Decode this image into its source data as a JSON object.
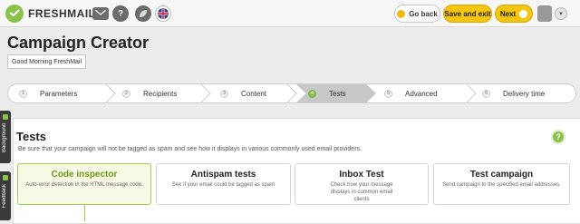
{
  "app": {
    "brand": "FRESHMAIL"
  },
  "toolbar": {
    "back_label": "Go back",
    "save_label": "Save and exit",
    "next_label": "Next",
    "help_glyph": "?",
    "caret_glyph": "▾"
  },
  "header": {
    "title": "Campaign Creator",
    "greeting": "Good Morning FreshMail"
  },
  "steps": [
    {
      "num": "1",
      "label": "Parameters"
    },
    {
      "num": "2",
      "label": "Recipients"
    },
    {
      "num": "3",
      "label": "Content"
    },
    {
      "num": "4",
      "label": "Tests",
      "active": true
    },
    {
      "num": "5",
      "label": "Advanced"
    },
    {
      "num": "6",
      "label": "Delivery time"
    }
  ],
  "sidetabs": {
    "background": "Background",
    "feedback": "Feedback"
  },
  "main": {
    "heading": "Tests",
    "subheading": "Be sure that your campaign will not be tagged as spam and see how it displays in various commonly used email providers.",
    "help_glyph": "?",
    "cards": [
      {
        "title": "Code inspector",
        "desc": "Auto-error detection in the HTML message code."
      },
      {
        "title": "Antispam tests",
        "desc": "See if your email could be tagged as spam"
      },
      {
        "title": "Inbox Test",
        "desc": "Check how your message displays in common email clients"
      },
      {
        "title": "Test campaign",
        "desc": "Send campaign to the specified email addresses."
      }
    ]
  },
  "colors": {
    "accent": "#8bc34a",
    "button": "#f4c60f",
    "active_step": "#c8c8c8"
  }
}
